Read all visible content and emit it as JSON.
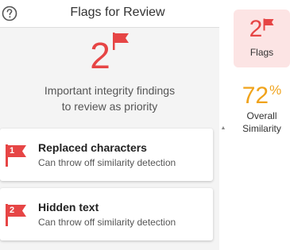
{
  "header": {
    "title": "Flags for Review",
    "help_icon": "question-circle-icon"
  },
  "summary": {
    "count": "2",
    "line1": "Important integrity findings",
    "line2": "to review as priority",
    "flag_color": "#e64545"
  },
  "flags": [
    {
      "number": "1",
      "title": "Replaced characters",
      "description": "Can throw off similarity detection"
    },
    {
      "number": "2",
      "title": "Hidden text",
      "description": "Can throw off similarity detection"
    }
  ],
  "sidebar": {
    "flags_tile": {
      "count": "2",
      "label": "Flags",
      "bg_color": "#fce4e4"
    },
    "similarity_tile": {
      "value": "72",
      "unit": "%",
      "label_line1": "Overall",
      "label_line2": "Similarity",
      "color": "#f0a31b"
    }
  }
}
